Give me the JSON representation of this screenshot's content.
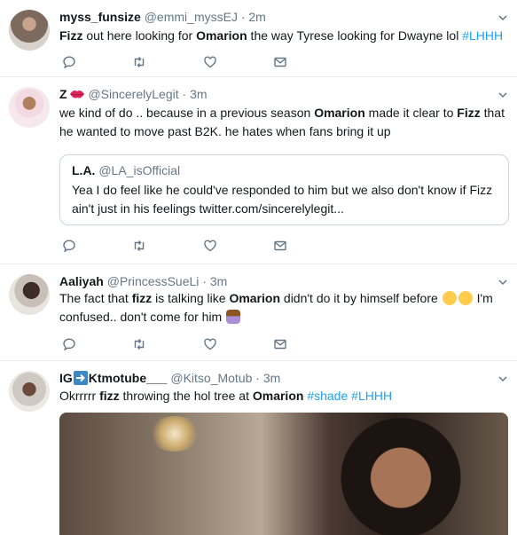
{
  "tweets": [
    {
      "name": "myss_funsize",
      "handle": "@emmi_myssEJ",
      "time": "2m",
      "line1_pre": "",
      "line1_b1": "Fizz",
      "line1_mid": " out here looking for ",
      "line1_b2": "Omarion",
      "line1_post": " the way Tyrese looking for Dwayne lol ",
      "line1_tag": "#LHHH"
    },
    {
      "name": "Z",
      "handle": "@SincerelyLegit",
      "time": "3m",
      "line1_pre": "we kind of do .. because in a previous season ",
      "line1_b1": "Omarion",
      "line1_mid": " made it clear to ",
      "line1_b2": "Fizz",
      "line1_post": " that",
      "line2": "he wanted to move past B2K. he hates when fans bring it up",
      "quote": {
        "name": "L.A.",
        "handle": "@LA_isOfficial",
        "line1": "Yea I do feel like he could've responded to him but we also don't know if Fizz",
        "line2": "ain't just in his feelings twitter.com/sincerelylegit..."
      }
    },
    {
      "name": "Aaliyah",
      "handle": "@PrincessSueLi",
      "time": "3m",
      "line1_pre": "The fact that ",
      "line1_b1": "fizz",
      "line1_mid": " is talking like ",
      "line1_b2": "Omarion",
      "line1_post": " didn't do it by himself before ",
      "line1_end": " I'm",
      "line2": "confused.. don't come for him "
    },
    {
      "name_pre": "IG",
      "name_post": "Ktmotube___",
      "handle": "@Kitso_Motub",
      "time": "3m",
      "line1_pre": "Okrrrrr ",
      "line1_b1": "fizz",
      "line1_mid": " throwing the hol tree at ",
      "line1_b2": "Omarion",
      "line1_post": " ",
      "tag1": "#shade",
      "tag2": "#LHHH"
    }
  ],
  "dot": "·",
  "icons": [
    "reply-icon",
    "retweet-icon",
    "like-icon",
    "dm-icon",
    "chevron-down-icon"
  ],
  "colors": {
    "accent": "#1da1f2",
    "secondary_text": "#657786",
    "border": "#e6ecf0"
  }
}
